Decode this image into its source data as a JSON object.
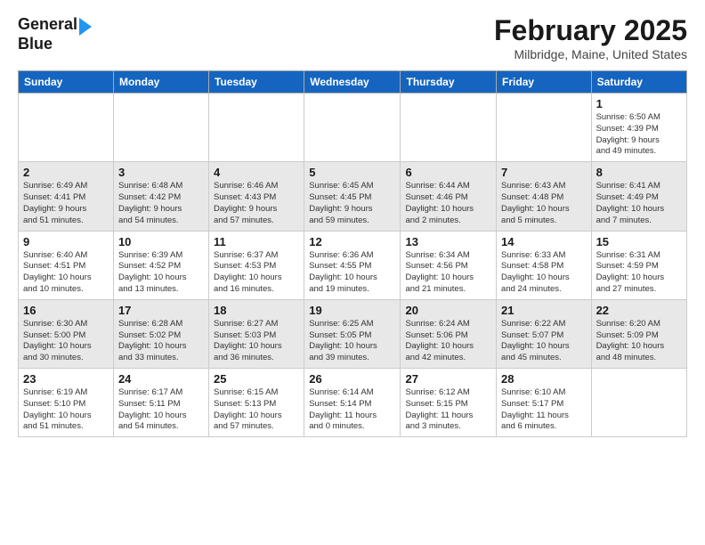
{
  "header": {
    "logo_line1": "General",
    "logo_line2": "Blue",
    "title": "February 2025",
    "subtitle": "Milbridge, Maine, United States"
  },
  "days_of_week": [
    "Sunday",
    "Monday",
    "Tuesday",
    "Wednesday",
    "Thursday",
    "Friday",
    "Saturday"
  ],
  "weeks": [
    {
      "alt": false,
      "days": [
        {
          "num": "",
          "info": ""
        },
        {
          "num": "",
          "info": ""
        },
        {
          "num": "",
          "info": ""
        },
        {
          "num": "",
          "info": ""
        },
        {
          "num": "",
          "info": ""
        },
        {
          "num": "",
          "info": ""
        },
        {
          "num": "1",
          "info": "Sunrise: 6:50 AM\nSunset: 4:39 PM\nDaylight: 9 hours\nand 49 minutes."
        }
      ]
    },
    {
      "alt": true,
      "days": [
        {
          "num": "2",
          "info": "Sunrise: 6:49 AM\nSunset: 4:41 PM\nDaylight: 9 hours\nand 51 minutes."
        },
        {
          "num": "3",
          "info": "Sunrise: 6:48 AM\nSunset: 4:42 PM\nDaylight: 9 hours\nand 54 minutes."
        },
        {
          "num": "4",
          "info": "Sunrise: 6:46 AM\nSunset: 4:43 PM\nDaylight: 9 hours\nand 57 minutes."
        },
        {
          "num": "5",
          "info": "Sunrise: 6:45 AM\nSunset: 4:45 PM\nDaylight: 9 hours\nand 59 minutes."
        },
        {
          "num": "6",
          "info": "Sunrise: 6:44 AM\nSunset: 4:46 PM\nDaylight: 10 hours\nand 2 minutes."
        },
        {
          "num": "7",
          "info": "Sunrise: 6:43 AM\nSunset: 4:48 PM\nDaylight: 10 hours\nand 5 minutes."
        },
        {
          "num": "8",
          "info": "Sunrise: 6:41 AM\nSunset: 4:49 PM\nDaylight: 10 hours\nand 7 minutes."
        }
      ]
    },
    {
      "alt": false,
      "days": [
        {
          "num": "9",
          "info": "Sunrise: 6:40 AM\nSunset: 4:51 PM\nDaylight: 10 hours\nand 10 minutes."
        },
        {
          "num": "10",
          "info": "Sunrise: 6:39 AM\nSunset: 4:52 PM\nDaylight: 10 hours\nand 13 minutes."
        },
        {
          "num": "11",
          "info": "Sunrise: 6:37 AM\nSunset: 4:53 PM\nDaylight: 10 hours\nand 16 minutes."
        },
        {
          "num": "12",
          "info": "Sunrise: 6:36 AM\nSunset: 4:55 PM\nDaylight: 10 hours\nand 19 minutes."
        },
        {
          "num": "13",
          "info": "Sunrise: 6:34 AM\nSunset: 4:56 PM\nDaylight: 10 hours\nand 21 minutes."
        },
        {
          "num": "14",
          "info": "Sunrise: 6:33 AM\nSunset: 4:58 PM\nDaylight: 10 hours\nand 24 minutes."
        },
        {
          "num": "15",
          "info": "Sunrise: 6:31 AM\nSunset: 4:59 PM\nDaylight: 10 hours\nand 27 minutes."
        }
      ]
    },
    {
      "alt": true,
      "days": [
        {
          "num": "16",
          "info": "Sunrise: 6:30 AM\nSunset: 5:00 PM\nDaylight: 10 hours\nand 30 minutes."
        },
        {
          "num": "17",
          "info": "Sunrise: 6:28 AM\nSunset: 5:02 PM\nDaylight: 10 hours\nand 33 minutes."
        },
        {
          "num": "18",
          "info": "Sunrise: 6:27 AM\nSunset: 5:03 PM\nDaylight: 10 hours\nand 36 minutes."
        },
        {
          "num": "19",
          "info": "Sunrise: 6:25 AM\nSunset: 5:05 PM\nDaylight: 10 hours\nand 39 minutes."
        },
        {
          "num": "20",
          "info": "Sunrise: 6:24 AM\nSunset: 5:06 PM\nDaylight: 10 hours\nand 42 minutes."
        },
        {
          "num": "21",
          "info": "Sunrise: 6:22 AM\nSunset: 5:07 PM\nDaylight: 10 hours\nand 45 minutes."
        },
        {
          "num": "22",
          "info": "Sunrise: 6:20 AM\nSunset: 5:09 PM\nDaylight: 10 hours\nand 48 minutes."
        }
      ]
    },
    {
      "alt": false,
      "days": [
        {
          "num": "23",
          "info": "Sunrise: 6:19 AM\nSunset: 5:10 PM\nDaylight: 10 hours\nand 51 minutes."
        },
        {
          "num": "24",
          "info": "Sunrise: 6:17 AM\nSunset: 5:11 PM\nDaylight: 10 hours\nand 54 minutes."
        },
        {
          "num": "25",
          "info": "Sunrise: 6:15 AM\nSunset: 5:13 PM\nDaylight: 10 hours\nand 57 minutes."
        },
        {
          "num": "26",
          "info": "Sunrise: 6:14 AM\nSunset: 5:14 PM\nDaylight: 11 hours\nand 0 minutes."
        },
        {
          "num": "27",
          "info": "Sunrise: 6:12 AM\nSunset: 5:15 PM\nDaylight: 11 hours\nand 3 minutes."
        },
        {
          "num": "28",
          "info": "Sunrise: 6:10 AM\nSunset: 5:17 PM\nDaylight: 11 hours\nand 6 minutes."
        },
        {
          "num": "",
          "info": ""
        }
      ]
    }
  ]
}
